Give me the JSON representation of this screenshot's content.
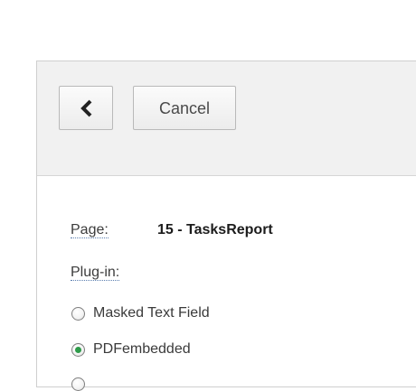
{
  "toolbar": {
    "back_icon": "chevron-left-icon",
    "cancel_label": "Cancel"
  },
  "form": {
    "page_label": "Page:",
    "page_value": "15 - TasksReport",
    "plugin_label": "Plug-in:",
    "plugin_options": [
      {
        "label": "Masked Text Field",
        "selected": false
      },
      {
        "label": "PDFembedded",
        "selected": true
      }
    ]
  },
  "colors": {
    "toolbar_bg": "#f1f1f1",
    "radio_selected": "#2e9b4a",
    "label_underline": "#5b7fb0"
  }
}
